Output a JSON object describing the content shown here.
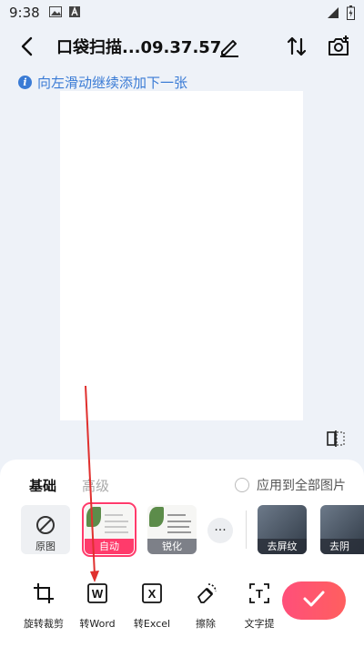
{
  "status_bar": {
    "time": "9:38"
  },
  "app_bar": {
    "title": "口袋扫描...09.37.57"
  },
  "hint": {
    "text": "向左滑动继续添加下一张"
  },
  "panel": {
    "tabs": [
      "基础",
      "高级"
    ],
    "apply_all_label": "应用到全部图片",
    "filters": [
      {
        "label": "原图"
      },
      {
        "label": "自动"
      },
      {
        "label": "锐化"
      },
      {
        "label": "去屏纹"
      },
      {
        "label": "去阴"
      }
    ],
    "more_label": "···"
  },
  "toolbar": {
    "tools": [
      {
        "label": "旋转裁剪",
        "icon": "crop-rotate-icon"
      },
      {
        "label": "转Word",
        "icon": "word-icon",
        "glyph": "W"
      },
      {
        "label": "转Excel",
        "icon": "excel-icon",
        "glyph": "X"
      },
      {
        "label": "擦除",
        "icon": "eraser-icon"
      },
      {
        "label": "文字提",
        "icon": "text-extract-icon",
        "glyph": "T"
      }
    ]
  },
  "colors": {
    "accent": "#ff3b6b",
    "hint_blue": "#3a7bd5",
    "annotation_arrow": "#e0302e"
  }
}
